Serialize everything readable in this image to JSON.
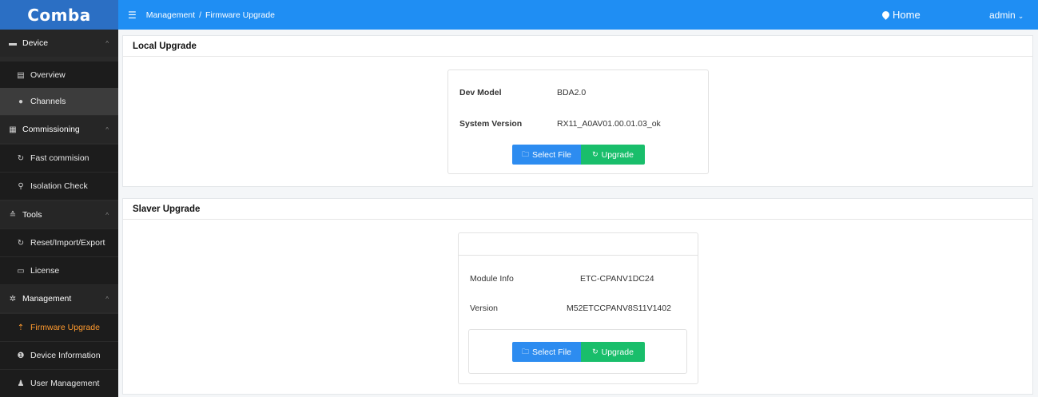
{
  "app": {
    "logo": "Comba"
  },
  "header": {
    "breadcrumb": [
      "Management",
      "Firmware Upgrade"
    ],
    "breadcrumb_sep": "/",
    "home_label": "Home",
    "user_label": "admin"
  },
  "sidebar": {
    "groups": [
      {
        "label": "Device",
        "icon": "monitor-icon"
      },
      {
        "label": "Commissioning",
        "icon": "grid-icon"
      },
      {
        "label": "Tools",
        "icon": "tools-icon"
      },
      {
        "label": "Management",
        "icon": "gear-icon"
      }
    ],
    "items": [
      {
        "label": "Overview",
        "icon": "document-icon"
      },
      {
        "label": "Channels",
        "icon": "shield-icon"
      },
      {
        "label": "Fast commision",
        "icon": "refresh-icon"
      },
      {
        "label": "Isolation Check",
        "icon": "search-icon"
      },
      {
        "label": "Reset/Import/Export",
        "icon": "refresh-icon"
      },
      {
        "label": "License",
        "icon": "license-icon"
      },
      {
        "label": "Firmware Upgrade",
        "icon": "upload-icon"
      },
      {
        "label": "Device Information",
        "icon": "info-icon"
      },
      {
        "label": "User Management",
        "icon": "user-icon"
      }
    ],
    "active_item": "Firmware Upgrade",
    "active_color": "#ff9a2e"
  },
  "local": {
    "title": "Local Upgrade",
    "model_label": "Dev Model",
    "model_value": "BDA2.0",
    "version_label": "System Version",
    "version_value": "RX11_A0AV01.00.01.03_ok",
    "select_label": "Select File",
    "upgrade_label": "Upgrade"
  },
  "slaver": {
    "title": "Slaver Upgrade",
    "module_label": "Module Info",
    "module_value": "ETC-CPANV1DC24",
    "version_label": "Version",
    "version_value": "M52ETCCPANV8S11V1402",
    "select_label": "Select File",
    "upgrade_label": "Upgrade"
  },
  "colors": {
    "header": "#1f8ef3",
    "logo_bg": "#2b6fc4",
    "select_button": "#2d8cf0",
    "upgrade_button": "#19be6b"
  }
}
